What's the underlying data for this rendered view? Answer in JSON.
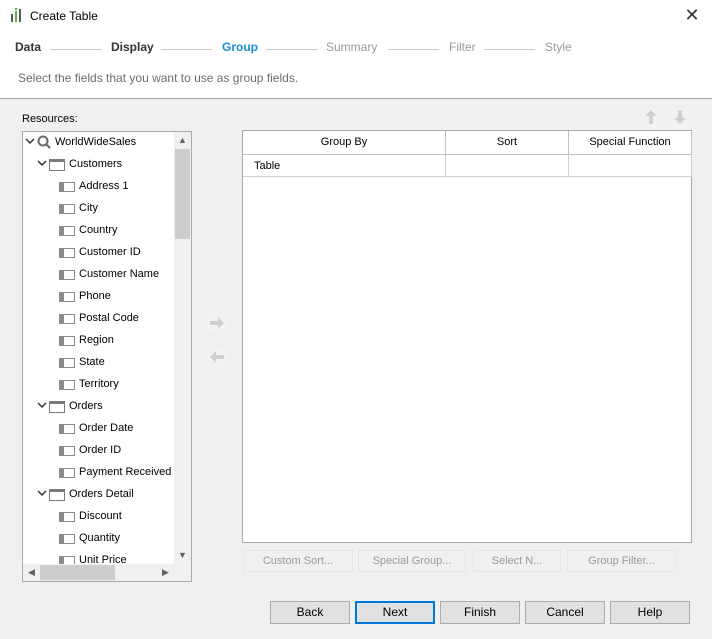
{
  "window": {
    "title": "Create Table",
    "close_glyph": "✕"
  },
  "steps": [
    {
      "label": "Data",
      "state": "done"
    },
    {
      "label": "Display",
      "state": "done"
    },
    {
      "label": "Group",
      "state": "active"
    },
    {
      "label": "Summary",
      "state": "future"
    },
    {
      "label": "Filter",
      "state": "future"
    },
    {
      "label": "Style",
      "state": "future"
    }
  ],
  "instruction": "Select the fields that you want to use as group fields.",
  "resources": {
    "label": "Resources:",
    "tree": [
      {
        "label": "WorldWideSales",
        "kind": "query",
        "expanded": true
      },
      {
        "label": "Customers",
        "kind": "table",
        "expanded": true
      },
      {
        "label": "Address 1",
        "kind": "field"
      },
      {
        "label": "City",
        "kind": "field"
      },
      {
        "label": "Country",
        "kind": "field"
      },
      {
        "label": "Customer ID",
        "kind": "field"
      },
      {
        "label": "Customer Name",
        "kind": "field"
      },
      {
        "label": "Phone",
        "kind": "field"
      },
      {
        "label": "Postal Code",
        "kind": "field"
      },
      {
        "label": "Region",
        "kind": "field"
      },
      {
        "label": "State",
        "kind": "field"
      },
      {
        "label": "Territory",
        "kind": "field"
      },
      {
        "label": "Orders",
        "kind": "table",
        "expanded": true
      },
      {
        "label": "Order Date",
        "kind": "field"
      },
      {
        "label": "Order ID",
        "kind": "field"
      },
      {
        "label": "Payment Received",
        "kind": "field"
      },
      {
        "label": "Orders Detail",
        "kind": "table",
        "expanded": true
      },
      {
        "label": "Discount",
        "kind": "field"
      },
      {
        "label": "Quantity",
        "kind": "field"
      },
      {
        "label": "Unit Price",
        "kind": "field"
      }
    ]
  },
  "grid": {
    "columns": [
      "Group By",
      "Sort",
      "Special Function"
    ],
    "rows": [
      [
        "Table",
        "",
        ""
      ]
    ]
  },
  "actions": [
    "Custom Sort...",
    "Special Group...",
    "Select N...",
    "Group Filter..."
  ],
  "footer": [
    "Back",
    "Next",
    "Finish",
    "Cancel",
    "Help"
  ],
  "colors": {
    "active_step": "#1a8fd8",
    "default_button_border": "#0078d7"
  }
}
